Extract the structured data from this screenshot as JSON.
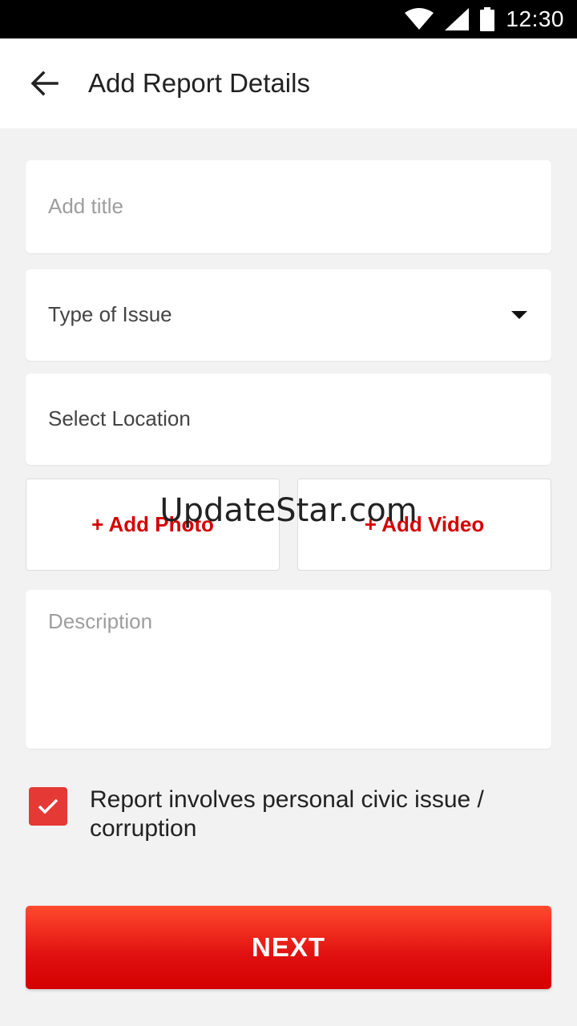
{
  "status_bar": {
    "time": "12:30"
  },
  "header": {
    "title": "Add Report Details"
  },
  "form": {
    "title_placeholder": "Add title",
    "issue_type_label": "Type of Issue",
    "location_label": "Select Location",
    "add_photo_label": "+ Add Photo",
    "add_video_label": "+ Add Video",
    "description_placeholder": "Description",
    "checkbox_label": "Report involves personal civic issue / corruption",
    "checkbox_checked": true,
    "next_label": "NEXT"
  },
  "watermark": "UpdateStar.com",
  "colors": {
    "accent": "#d50000",
    "checkbox": "#e53935",
    "background": "#f2f2f2"
  }
}
